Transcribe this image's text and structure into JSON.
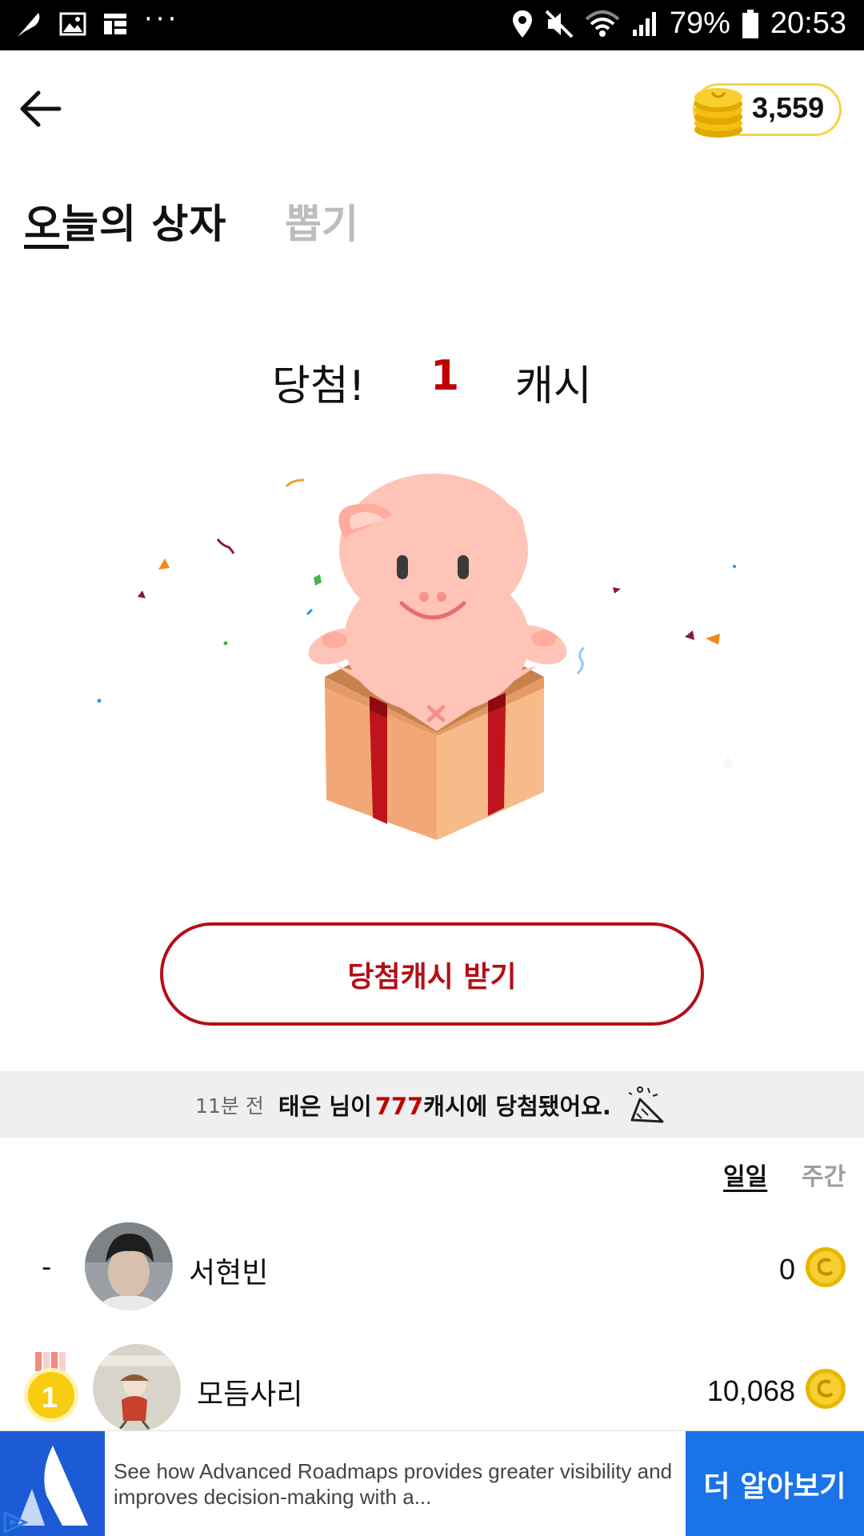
{
  "status_bar": {
    "battery": "79%",
    "time": "20:53",
    "overflow": "···",
    "icons": [
      "feather-icon",
      "gallery-icon",
      "news-icon",
      "location-icon",
      "mute-icon",
      "wifi-icon",
      "signal-icon",
      "battery-icon"
    ]
  },
  "header": {
    "back_icon": "arrow-left-icon",
    "coin_balance": "3,559"
  },
  "tabs": {
    "today": "오늘의 상자",
    "draw": "뽑기"
  },
  "result": {
    "prefix": "당첨!",
    "amount": "1",
    "unit": "캐시"
  },
  "claim_button": {
    "label": "당첨캐시 받기"
  },
  "notice": {
    "time": "11분 전",
    "before": "태은 님이",
    "amount": "777",
    "after": "캐시에 당첨됐어요."
  },
  "period": {
    "daily": "일일",
    "weekly": "주간"
  },
  "ranking": [
    {
      "rank": "-",
      "name": "서현빈",
      "score": "0"
    },
    {
      "rank": "1",
      "name": "모듬사리",
      "score": "10,068"
    }
  ],
  "ad": {
    "text": "See how Advanced Roadmaps provides greater visibility and improves decision-making with a...",
    "cta": "더 알아보기"
  },
  "colors": {
    "accent_red": "#c00000",
    "button_border": "#b50f16",
    "coin_gold": "#f5c518",
    "ad_blue": "#1a73e8"
  }
}
